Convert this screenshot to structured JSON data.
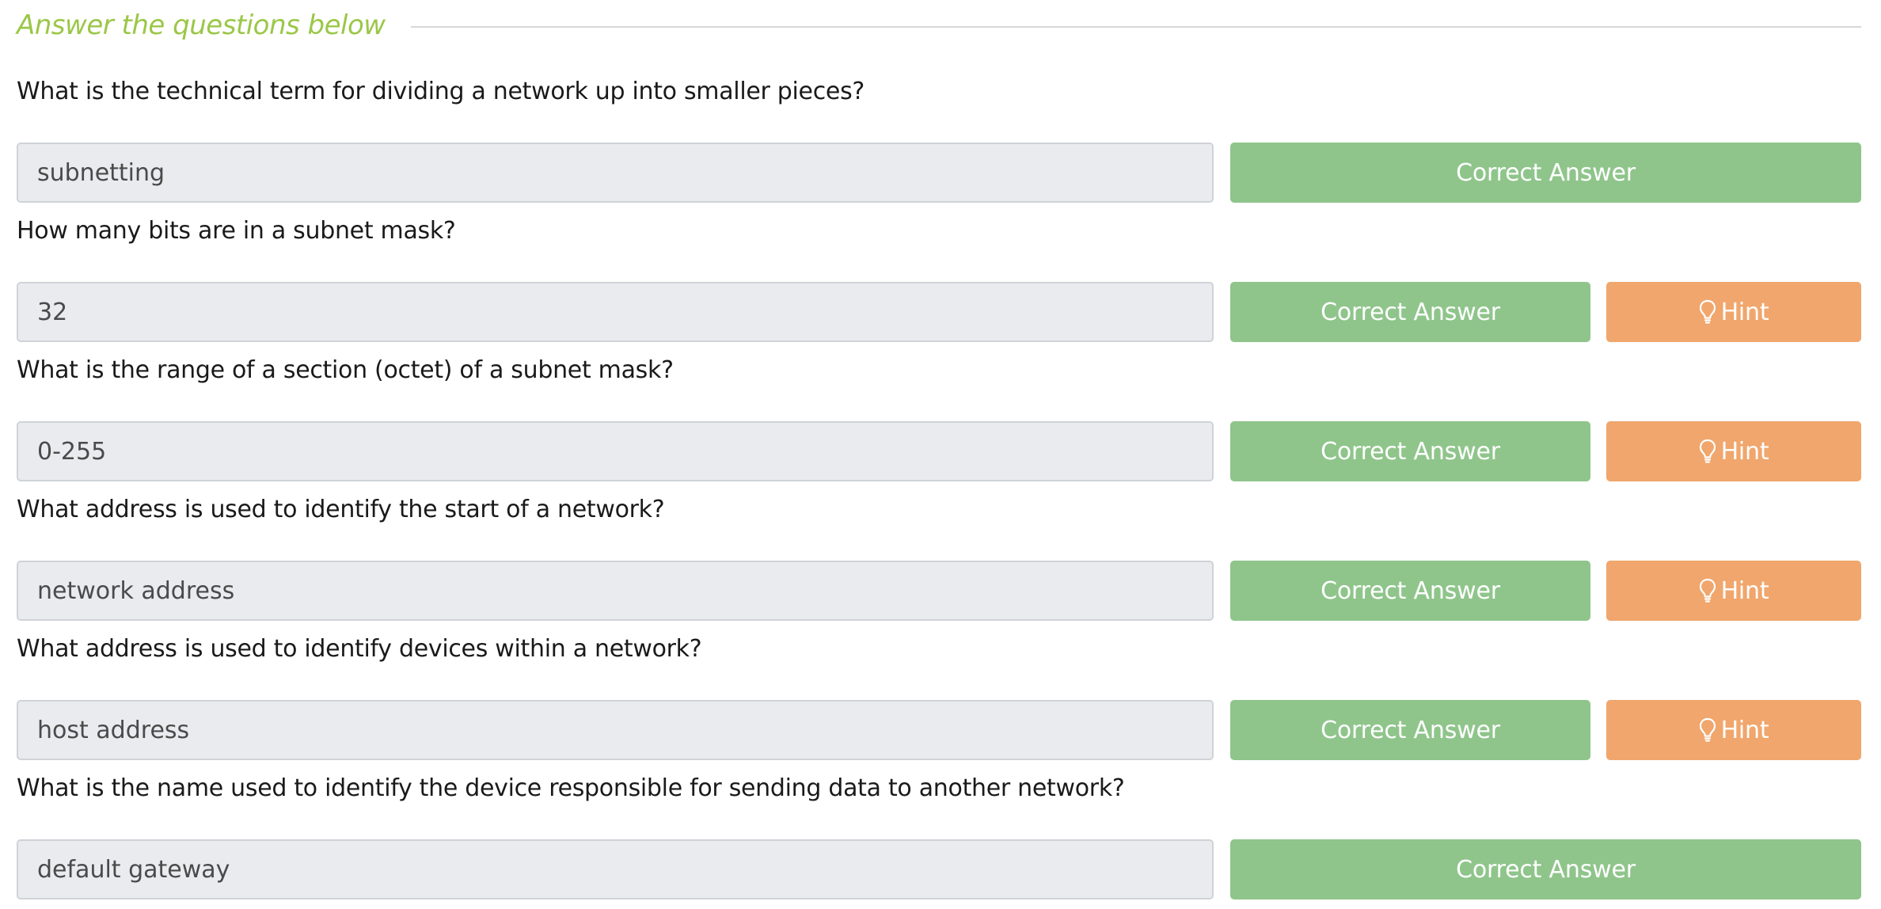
{
  "section": {
    "title": "Answer the questions below"
  },
  "questions": [
    {
      "label": "What is the technical term for dividing a network up into smaller pieces?",
      "answer": "subnetting",
      "button_label": "Correct Answer",
      "has_hint": false
    },
    {
      "label": "How many bits are in a subnet mask?",
      "answer": "32",
      "button_label": "Correct Answer",
      "has_hint": true,
      "hint_label": "Hint"
    },
    {
      "label": "What is the range of a section (octet) of a subnet mask?",
      "answer": "0-255",
      "button_label": "Correct Answer",
      "has_hint": true,
      "hint_label": "Hint"
    },
    {
      "label": "What address is used to identify the start of a network?",
      "answer": "network address",
      "button_label": "Correct Answer",
      "has_hint": true,
      "hint_label": "Hint"
    },
    {
      "label": "What address is used to identify devices within a network?",
      "answer": "host address",
      "button_label": "Correct Answer",
      "has_hint": true,
      "hint_label": "Hint"
    },
    {
      "label": "What is the name used to identify the device responsible for sending data to another network?",
      "answer": "default gateway",
      "button_label": "Correct Answer",
      "has_hint": false
    }
  ],
  "colors": {
    "title": "#9bc748",
    "correct_button": "#8fc58b",
    "hint_button": "#f0a66c",
    "input_background": "#e9ebee"
  },
  "icons": {
    "hint": "lightbulb-icon"
  }
}
